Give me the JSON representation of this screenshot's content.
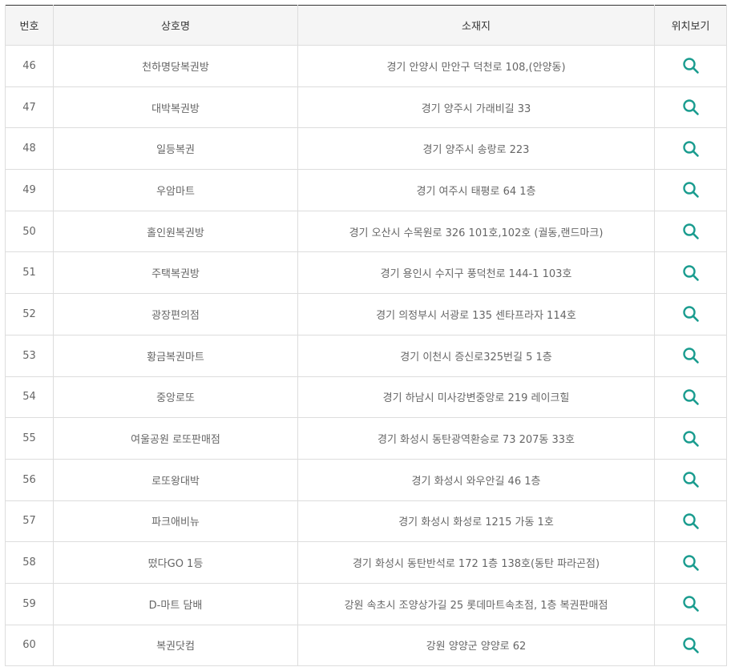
{
  "header": {
    "num": "번호",
    "name": "상호명",
    "address": "소재지",
    "location": "위치보기"
  },
  "accent_color": "#1a9c8f",
  "rows": [
    {
      "num": "46",
      "name": "천하명당복권방",
      "address": "경기 안양시 만안구 덕천로 108,(안양동)"
    },
    {
      "num": "47",
      "name": "대박복권방",
      "address": "경기 양주시 가래비길 33"
    },
    {
      "num": "48",
      "name": "일등복권",
      "address": "경기 양주시 송랑로 223"
    },
    {
      "num": "49",
      "name": "우암마트",
      "address": "경기 여주시 태평로 64 1층"
    },
    {
      "num": "50",
      "name": "홀인원복권방",
      "address": "경기 오산시 수목원로 326 101호,102호 (궐동,랜드마크)"
    },
    {
      "num": "51",
      "name": "주택복권방",
      "address": "경기 용인시 수지구 풍덕천로 144-1 103호"
    },
    {
      "num": "52",
      "name": "광장편의점",
      "address": "경기 의정부시 서광로 135 센타프라자 114호"
    },
    {
      "num": "53",
      "name": "황금복권마트",
      "address": "경기 이천시 증신로325번길 5 1층"
    },
    {
      "num": "54",
      "name": "중앙로또",
      "address": "경기 하남시 미사강변중앙로 219 레이크힐"
    },
    {
      "num": "55",
      "name": "여울공원 로또판매점",
      "address": "경기 화성시 동탄광역환승로 73 207동 33호"
    },
    {
      "num": "56",
      "name": "로또왕대박",
      "address": "경기 화성시 와우안길 46 1층"
    },
    {
      "num": "57",
      "name": "파크애비뉴",
      "address": "경기 화성시 화성로 1215 가동 1호"
    },
    {
      "num": "58",
      "name": "떴다GO 1등",
      "address": "경기 화성시 동탄반석로 172 1층 138호(동탄 파라곤점)"
    },
    {
      "num": "59",
      "name": "D-마트 담배",
      "address": "강원 속초시 조양상가길 25 롯데마트속초점, 1층 복권판매점"
    },
    {
      "num": "60",
      "name": "복권닷컴",
      "address": "강원 양양군 양양로 62"
    }
  ],
  "icon": "search-icon"
}
